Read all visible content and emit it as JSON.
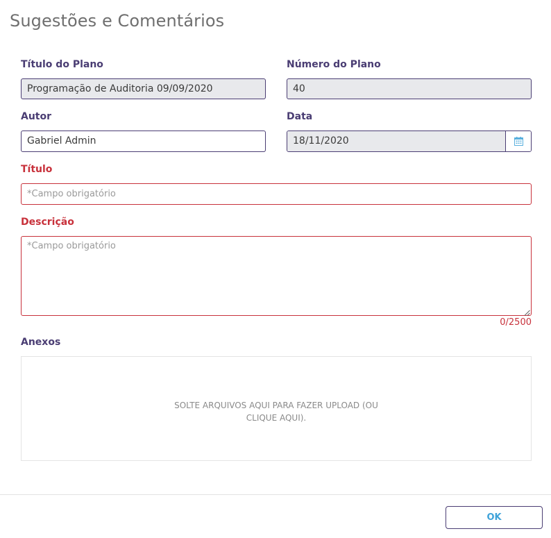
{
  "dialog": {
    "title": "Sugestões e Comentários"
  },
  "form": {
    "plan_title": {
      "label": "Título do Plano",
      "value": "Programação de Auditoria 09/09/2020"
    },
    "plan_number": {
      "label": "Número do Plano",
      "value": "40"
    },
    "author": {
      "label": "Autor",
      "value": "Gabriel Admin"
    },
    "date": {
      "label": "Data",
      "value": "18/11/2020",
      "icon": "calendar-icon"
    },
    "title": {
      "label": "Título",
      "placeholder": "*Campo obrigatório"
    },
    "description": {
      "label": "Descrição",
      "placeholder": "*Campo obrigatório",
      "counter": "0/2500"
    },
    "attachments": {
      "label": "Anexos",
      "dropzone_text": "SOLTE ARQUIVOS AQUI PARA FAZER UPLOAD (OU CLIQUE AQUI)."
    }
  },
  "footer": {
    "ok_label": "OK"
  },
  "colors": {
    "label": "#4a3d73",
    "error": "#c8313b",
    "readonly_bg": "#e8e9ec",
    "accent": "#3fa3d9"
  }
}
